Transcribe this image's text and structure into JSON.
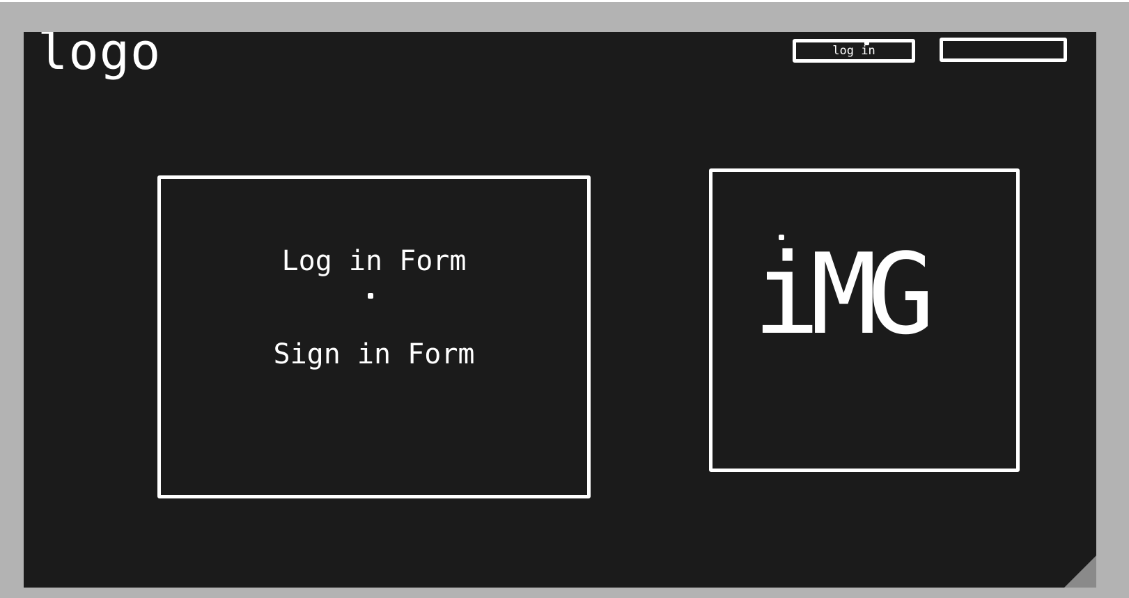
{
  "header": {
    "logo_text": "logo",
    "login_button_label": "log in",
    "second_button_label": ""
  },
  "main": {
    "form_panel": {
      "login_form_label": "Log in Form",
      "signin_form_label": "Sign in Form"
    },
    "image_panel": {
      "placeholder_label": "iMG"
    }
  },
  "colors": {
    "background": "#1b1b1b",
    "frame": "#b3b3b3",
    "stroke": "#ffffff",
    "corner_fold": "#8a8a8a"
  }
}
